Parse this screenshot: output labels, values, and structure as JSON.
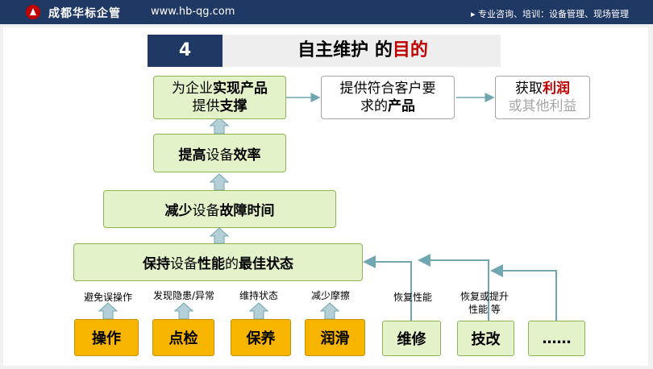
{
  "header": {
    "brand": "成都华标企管",
    "url": "www.hb-qg.com",
    "services": "▸ 专业咨询、培训：设备管理、现场管理"
  },
  "title": {
    "number": "4",
    "text_plain": "自主维护 的",
    "text_emph": "目的"
  },
  "goals": {
    "support_a": "为企业",
    "support_b": "实现产品",
    "support_c": "提供",
    "support_d": "支撑",
    "customer_a": "提供符合客户要",
    "customer_b": "求的",
    "customer_c": "产品",
    "profit_a": "获取",
    "profit_b": "利润",
    "profit_c": "或其他利益"
  },
  "levels": {
    "efficiency_a": "提高",
    "efficiency_b": "设备",
    "efficiency_c": "效率",
    "downtime_a": "减少",
    "downtime_b": "设备",
    "downtime_c": "故障时间",
    "state_a": "保持",
    "state_b": "设备",
    "state_c": "性能",
    "state_d": "的",
    "state_e": "最佳状态"
  },
  "actions": [
    {
      "label": "操作",
      "note": "避免误操作"
    },
    {
      "label": "点检",
      "note": "发现隐患/异常"
    },
    {
      "label": "保养",
      "note": "维持状态"
    },
    {
      "label": "润滑",
      "note": "减少摩擦"
    },
    {
      "label": "维修",
      "note": "恢复性能"
    },
    {
      "label": "技改",
      "note_a": "恢复或提升",
      "note_b": "性能  等"
    },
    {
      "label": "……"
    }
  ]
}
